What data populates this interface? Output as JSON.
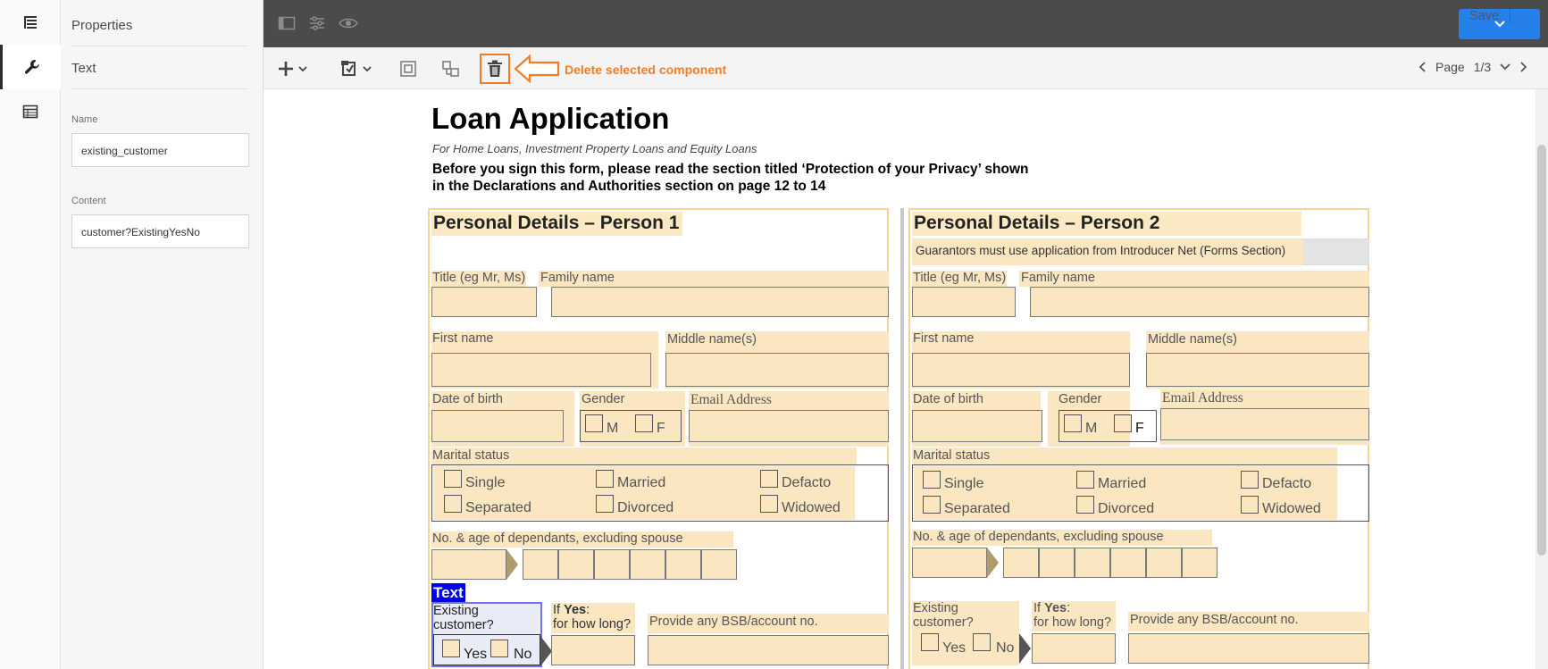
{
  "rail": {
    "icons": [
      "content-tree-icon",
      "wrench-icon",
      "data-model-icon"
    ]
  },
  "properties": {
    "title": "Properties",
    "component": "Text",
    "name_label": "Name",
    "name_value": "existing_customer",
    "content_label": "Content",
    "content_value": "customer?ExistingYesNo"
  },
  "topbar": {
    "save_label": "Save",
    "icons": [
      "toggle-panel-icon",
      "sliders-icon",
      "preview-icon"
    ]
  },
  "toolbar": {
    "callout": "Delete selected component",
    "page_label": "Page",
    "page_value": "1/3",
    "accent": "#f07d2a"
  },
  "doc": {
    "title": "Loan Application",
    "subtitle": "For Home Loans, Investment Property Loans and Equity Loans",
    "warning_1": "Before you sign this form, please read the section titled ‘Protection of your Privacy’ shown",
    "warning_2": "in the Declarations and Authorities section on page 12 to 14"
  },
  "p1": {
    "title": "Personal Details – Person 1",
    "title_lbl": "Title (eg Mr, Ms)",
    "family": "Family name",
    "first": "First name",
    "middle": "Middle name(s)",
    "dob": "Date of birth",
    "gender": "Gender",
    "m": "M",
    "f": "F",
    "email": "Email Address",
    "marital": "Marital status",
    "single": "Single",
    "married": "Married",
    "defacto": "Defacto",
    "separated": "Separated",
    "divorced": "Divorced",
    "widowed": "Widowed",
    "dependants": "No. & age of dependants, excluding spouse",
    "text_tag": "Text",
    "existing_1": "Existing",
    "existing_2": "customer?",
    "yes": "Yes",
    "no": "No",
    "if_yes": "Yes",
    "if_prefix": "If ",
    "if_colon": ":",
    "how_long": "for how long?",
    "bsb": "Provide any BSB/account no."
  },
  "p2": {
    "title": "Personal Details – Person 2",
    "note": "Guarantors must use application from Introducer Net (Forms Section)"
  }
}
